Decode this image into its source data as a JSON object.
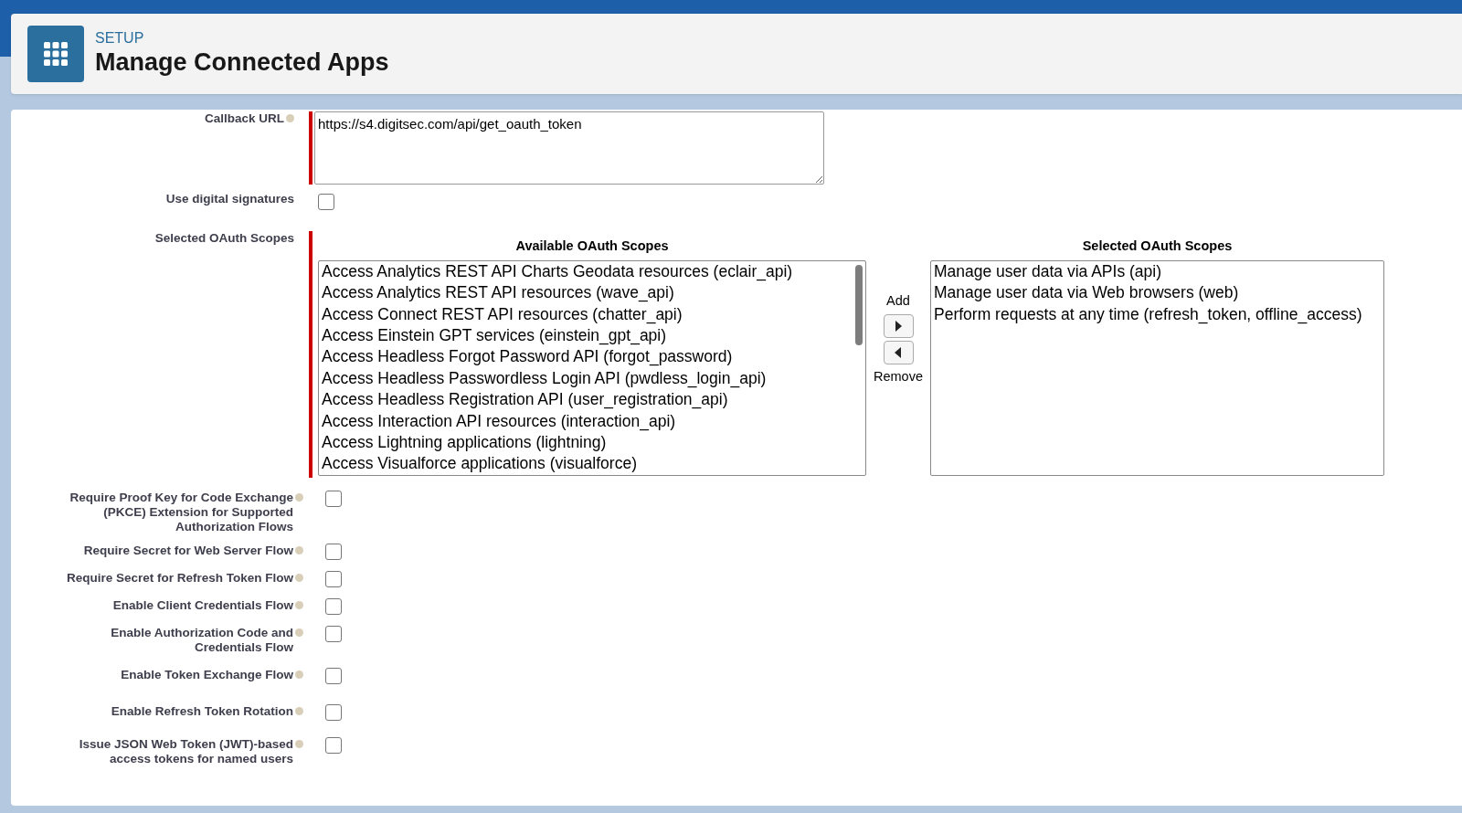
{
  "header": {
    "eyebrow": "SETUP",
    "title": "Manage Connected Apps"
  },
  "callback": {
    "label": "Callback URL",
    "help": true,
    "required": true,
    "value": "https://s4.digitsec.com/api/get_oauth_token"
  },
  "digital_signatures": {
    "label": "Use digital signatures",
    "help": false,
    "checked": false
  },
  "scopes": {
    "label": "Selected OAuth Scopes",
    "required": true,
    "available_title": "Available OAuth Scopes",
    "available": [
      "Access Analytics REST API Charts Geodata resources (eclair_api)",
      "Access Analytics REST API resources (wave_api)",
      "Access Connect REST API resources (chatter_api)",
      "Access Einstein GPT services (einstein_gpt_api)",
      "Access Headless Forgot Password API (forgot_password)",
      "Access Headless Passwordless Login API (pwdless_login_api)",
      "Access Headless Registration API (user_registration_api)",
      "Access Interaction API resources (interaction_api)",
      "Access Lightning applications (lightning)",
      "Access Visualforce applications (visualforce)"
    ],
    "add_label": "Add",
    "remove_label": "Remove",
    "selected_title": "Selected OAuth Scopes",
    "selected": [
      "Manage user data via APIs (api)",
      "Manage user data via Web browsers (web)",
      "Perform requests at any time (refresh_token, offline_access)"
    ]
  },
  "options": [
    {
      "label": "Require Proof Key for Code Exchange (PKCE) Extension for Supported Authorization Flows",
      "help": true,
      "checked": false
    },
    {
      "label": "Require Secret for Web Server Flow",
      "help": true,
      "checked": false
    },
    {
      "label": "Require Secret for Refresh Token Flow",
      "help": true,
      "checked": false
    },
    {
      "label": "Enable Client Credentials Flow",
      "help": true,
      "checked": false
    },
    {
      "label": "Enable Authorization Code and Credentials Flow",
      "help": true,
      "checked": false
    },
    {
      "label": "Enable Token Exchange Flow",
      "help": true,
      "checked": false
    },
    {
      "label": "Enable Refresh Token Rotation",
      "help": true,
      "checked": false
    },
    {
      "label": "Issue JSON Web Token (JWT)-based access tokens for named users",
      "help": true,
      "checked": false
    }
  ]
}
